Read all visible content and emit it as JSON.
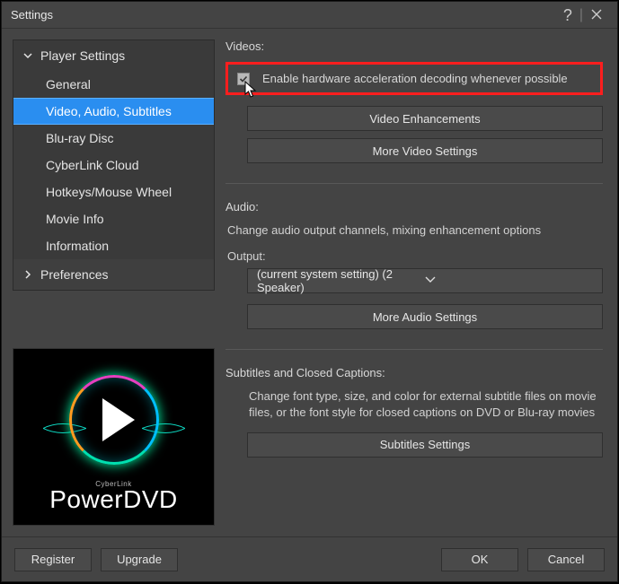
{
  "window": {
    "title": "Settings"
  },
  "sidebar": {
    "playerGroup": "Player Settings",
    "items": [
      "General",
      "Video, Audio, Subtitles",
      "Blu-ray Disc",
      "CyberLink Cloud",
      "Hotkeys/Mouse Wheel",
      "Movie Info",
      "Information"
    ],
    "preferences": "Preferences"
  },
  "logo": {
    "brand": "CyberLink",
    "product": "PowerDVD"
  },
  "videos": {
    "title": "Videos:",
    "enableHW": "Enable hardware acceleration decoding whenever possible",
    "enhancements": "Video Enhancements",
    "more": "More Video Settings"
  },
  "audio": {
    "title": "Audio:",
    "desc": "Change audio output channels, mixing enhancement options",
    "outputLabel": "Output:",
    "outputValue": "(current system setting) (2 Speaker)",
    "more": "More Audio Settings"
  },
  "subs": {
    "title": "Subtitles and Closed Captions:",
    "desc": "Change font type, size, and color for external subtitle files on movie files, or the font style for closed captions on DVD or Blu-ray movies",
    "btn": "Subtitles Settings"
  },
  "footer": {
    "register": "Register",
    "upgrade": "Upgrade",
    "ok": "OK",
    "cancel": "Cancel"
  }
}
